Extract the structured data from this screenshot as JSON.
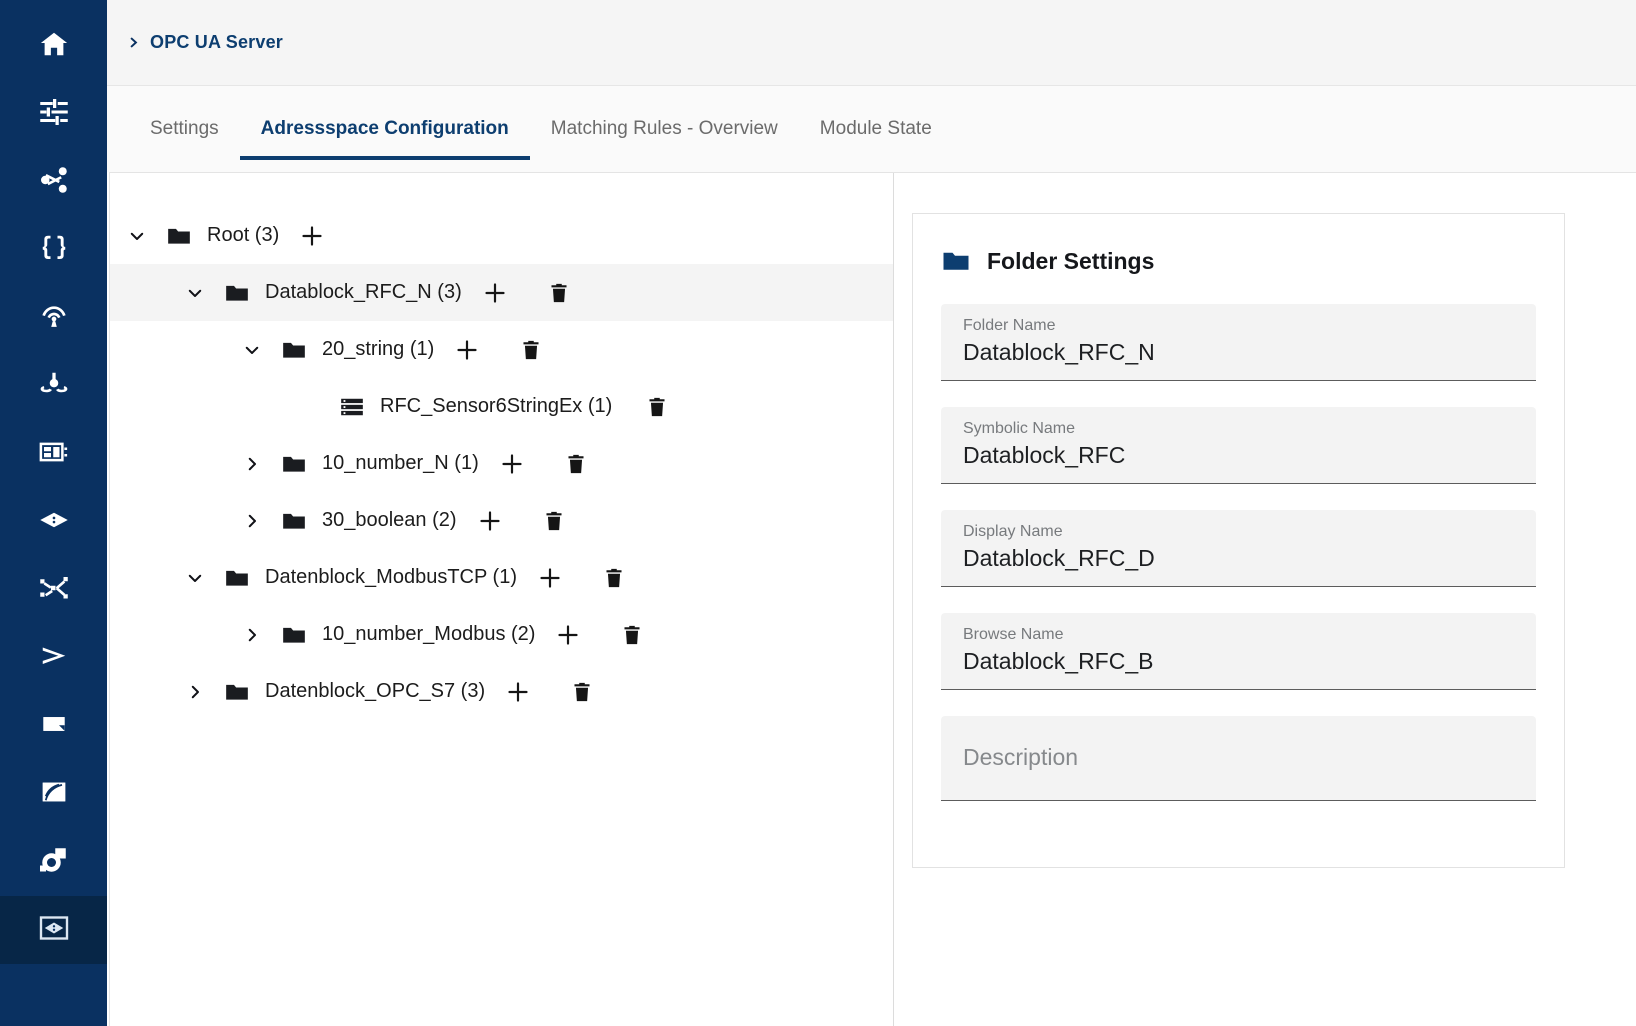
{
  "sidebar": {
    "items": [
      {
        "icon": "home-icon",
        "name": "sidebar-item-home",
        "active": false
      },
      {
        "icon": "sliders-icon",
        "name": "sidebar-item-settings",
        "active": false
      },
      {
        "icon": "share-nodes-icon",
        "name": "sidebar-item-share",
        "active": false
      },
      {
        "icon": "braces-icon",
        "name": "sidebar-item-json",
        "active": false
      },
      {
        "icon": "broadcast-icon",
        "name": "sidebar-item-broadcast",
        "active": false
      },
      {
        "icon": "hub-icon",
        "name": "sidebar-item-hub",
        "active": false
      },
      {
        "icon": "device-icon",
        "name": "sidebar-item-device",
        "active": false
      },
      {
        "icon": "diamond-icon",
        "name": "sidebar-item-opcua",
        "active": false
      },
      {
        "icon": "shuffle-icon",
        "name": "sidebar-item-routing",
        "active": false
      },
      {
        "icon": "chevron-right-large-icon",
        "name": "sidebar-item-console",
        "active": false
      },
      {
        "icon": "file-icon",
        "name": "sidebar-item-files",
        "active": false
      },
      {
        "icon": "waves-icon",
        "name": "sidebar-item-signals",
        "active": false
      },
      {
        "icon": "connector-icon",
        "name": "sidebar-item-connector",
        "active": false
      },
      {
        "icon": "framed-diamond-icon",
        "name": "sidebar-item-opcua-server",
        "active": true
      }
    ]
  },
  "header": {
    "breadcrumb": "OPC UA Server",
    "breadcrumb_icon": "chevron-right-icon"
  },
  "tabs": [
    {
      "label": "Settings",
      "active": false
    },
    {
      "label": "Adressspace Configuration",
      "active": true
    },
    {
      "label": "Matching Rules - Overview",
      "active": false
    },
    {
      "label": "Module State",
      "active": false
    }
  ],
  "tree": {
    "nodes": [
      {
        "label": "Root (3)",
        "depth": 0,
        "state": "expanded",
        "icon": "folder-icon",
        "has_add": true,
        "has_delete": false,
        "selected": false
      },
      {
        "label": "Datablock_RFC_N (3)",
        "depth": 1,
        "state": "expanded",
        "icon": "folder-icon",
        "has_add": true,
        "has_delete": true,
        "selected": true
      },
      {
        "label": "20_string (1)",
        "depth": 2,
        "state": "expanded",
        "icon": "folder-icon",
        "has_add": true,
        "has_delete": true,
        "selected": false
      },
      {
        "label": "RFC_Sensor6StringEx (1)",
        "depth": 3,
        "state": "leaf",
        "icon": "variable-icon",
        "has_add": false,
        "has_delete": true,
        "selected": false
      },
      {
        "label": "10_number_N (1)",
        "depth": 2,
        "state": "collapsed",
        "icon": "folder-icon",
        "has_add": true,
        "has_delete": true,
        "selected": false
      },
      {
        "label": "30_boolean (2)",
        "depth": 2,
        "state": "collapsed",
        "icon": "folder-icon",
        "has_add": true,
        "has_delete": true,
        "selected": false
      },
      {
        "label": "Datenblock_ModbusTCP (1)",
        "depth": 1,
        "state": "expanded",
        "icon": "folder-icon",
        "has_add": true,
        "has_delete": true,
        "selected": false
      },
      {
        "label": "10_number_Modbus (2)",
        "depth": 2,
        "state": "collapsed",
        "icon": "folder-icon",
        "has_add": true,
        "has_delete": true,
        "selected": false
      },
      {
        "label": "Datenblock_OPC_S7 (3)",
        "depth": 1,
        "state": "collapsed",
        "icon": "folder-icon",
        "has_add": true,
        "has_delete": true,
        "selected": false
      }
    ]
  },
  "folder_settings": {
    "title": "Folder Settings",
    "title_icon": "folder-icon",
    "fields": [
      {
        "label": "Folder Name",
        "value": "Datablock_RFC_N",
        "placeholder": ""
      },
      {
        "label": "Symbolic Name",
        "value": "Datablock_RFC",
        "placeholder": ""
      },
      {
        "label": "Display Name",
        "value": "Datablock_RFC_D",
        "placeholder": ""
      },
      {
        "label": "Browse Name",
        "value": "Datablock_RFC_B",
        "placeholder": ""
      },
      {
        "label": "",
        "value": "",
        "placeholder": "Description"
      }
    ]
  },
  "colors": {
    "rail_bg": "#0a3161",
    "rail_active_bg": "#072647",
    "accent": "#0d3e70",
    "topbar_bg": "#f5f5f5",
    "selected_row_bg": "#f4f4f4",
    "field_bg": "#f3f3f3"
  }
}
